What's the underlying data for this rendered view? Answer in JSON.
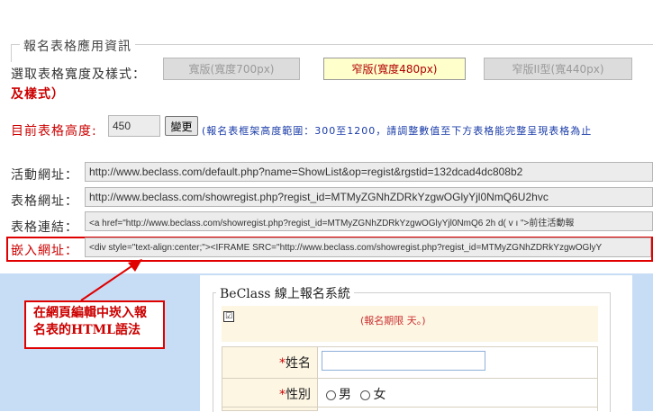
{
  "panel": {
    "legend": "報名表格應用資訊",
    "width_label": "選取表格寬度及樣式：",
    "width_label_cont": "及樣式）",
    "buttons": [
      {
        "label": "寬版(寬度700px)",
        "state": "inactive"
      },
      {
        "label": "窄版(寬度480px)",
        "state": "selected"
      },
      {
        "label": "窄版II型(寬440px)",
        "state": "inactive"
      }
    ],
    "height_label": "目前表格高度:",
    "height_value": "450",
    "update_label": "變更",
    "height_note": "(報名表框架高度範圍：300至1200，請調整數值至下方表格能完整呈現表格為止"
  },
  "urls": {
    "activity_label": "活動網址：",
    "activity_value": "http://www.beclass.com/default.php?name=ShowList&op=regist&rgstid=132dcad4dc808b2",
    "form_label": "表格網址：",
    "form_value": "http://www.beclass.com/showregist.php?regist_id=MTMyZGNhZDRkYzgwOGlyYjl0NmQ6U2hvc",
    "link_label": "表格連結：",
    "link_value": "<a href=\"http://www.beclass.com/showregist.php?regist_id=MTMyZGNhZDRkYzgwOGlyYjl0NmQ6  2h  d( v  ı    \">前往活動報",
    "embed_label": "嵌入網址：",
    "embed_value": "<div style=\"text-align:center;\"><IFRAME SRC=\"http://www.beclass.com/showregist.php?regist_id=MTMyZGNhZDRkYzgwOGlyY"
  },
  "callout": {
    "text": "在網頁編輯中崁入報名表的HTML語法"
  },
  "preview": {
    "legend": "BeClass 線上報名系統",
    "checkbox_mark": "☑",
    "notice": "(報名期限  天。)",
    "name_label": "姓名",
    "gender_label": "性別",
    "gender_male": "男",
    "gender_female": "女",
    "required_mark": "*"
  },
  "colors": {
    "accent_red": "#e00000",
    "preview_bg": "#c7dcf5",
    "selected_button_bg": "#ffffcc"
  }
}
